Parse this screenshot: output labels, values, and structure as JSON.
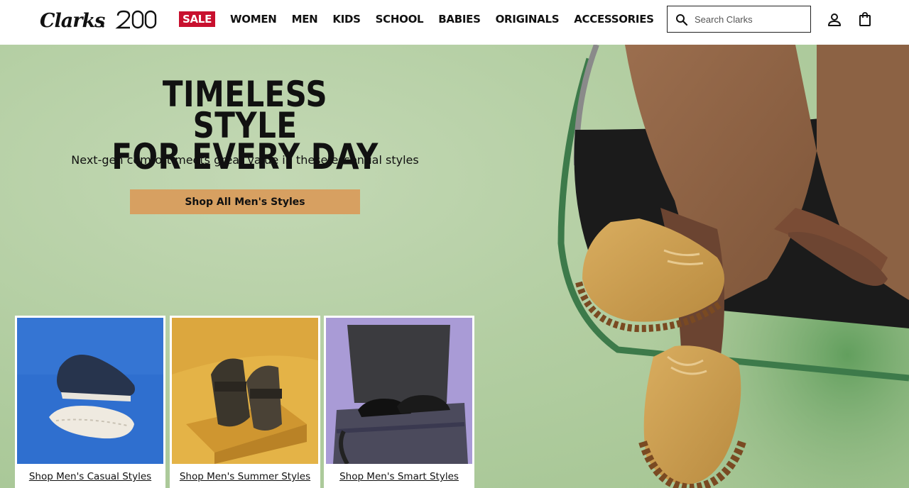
{
  "header": {
    "logo_text": "Clarks 200",
    "nav": {
      "sale": "SALE",
      "women": "WOMEN",
      "men": "MEN",
      "kids": "KIDS",
      "school": "SCHOOL",
      "babies": "BABIES",
      "originals": "ORIGINALS",
      "accessories": "ACCESSORIES"
    },
    "search": {
      "placeholder": "Search Clarks"
    },
    "icons": {
      "search": "search-icon",
      "account": "account-icon",
      "bag": "shopping-bag-icon"
    }
  },
  "hero": {
    "title_line1": "TIMELESS STYLE",
    "title_line2": "FOR EVERY DAY",
    "subtitle": "Next-gen comfort meets great value in these essential styles",
    "cta_label": "Shop All Men's Styles"
  },
  "tiles": [
    {
      "label": "Shop Men's Casual Styles"
    },
    {
      "label": "Shop Men's Summer Styles"
    },
    {
      "label": "Shop Men's Smart Styles"
    }
  ],
  "colors": {
    "sale_red": "#c8102e",
    "cta_tan": "#d7a061",
    "hero_green": "#b3cea2",
    "tile_blue": "#2f6fcf",
    "tile_yellow": "#e4b347",
    "tile_lavender": "#a99bd6"
  }
}
